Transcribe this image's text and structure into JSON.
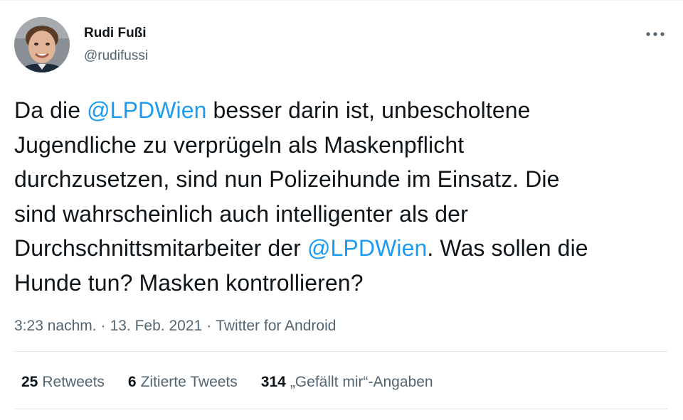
{
  "author": {
    "name": "Rudi Fußi",
    "handle": "@rudifussi"
  },
  "tweet": {
    "lines": [
      [
        {
          "text": "Da die "
        },
        {
          "text": "@LPDWien",
          "mention": true
        },
        {
          "text": " besser darin ist, unbescholtene"
        }
      ],
      [
        {
          "text": "Jugendliche zu verprügeln als Maskenpflicht"
        }
      ],
      [
        {
          "text": "durchzusetzen, sind nun Polizeihunde im Einsatz. Die"
        }
      ],
      [
        {
          "text": "sind wahrscheinlich auch intelligenter als der"
        }
      ],
      [
        {
          "text": "Durchschnittsmitarbeiter der "
        },
        {
          "text": "@LPDWien",
          "mention": true
        },
        {
          "text": ". Was sollen die"
        }
      ],
      [
        {
          "text": "Hunde tun? Masken kontrollieren?"
        }
      ]
    ]
  },
  "meta": {
    "time": "3:23 nachm.",
    "separator": "·",
    "date": "13. Feb. 2021",
    "source": "Twitter for Android"
  },
  "stats": [
    {
      "count": "25",
      "label": "Retweets",
      "name": "retweets"
    },
    {
      "count": "6",
      "label": "Zitierte Tweets",
      "name": "quote-tweets"
    },
    {
      "count": "314",
      "label": "„Gefällt mir“-Angaben",
      "name": "likes"
    }
  ],
  "colors": {
    "accent": "#1d9bf0",
    "text": "#0f1419",
    "secondary": "#536471"
  },
  "icons": {
    "more": "more-horizontal-icon"
  }
}
